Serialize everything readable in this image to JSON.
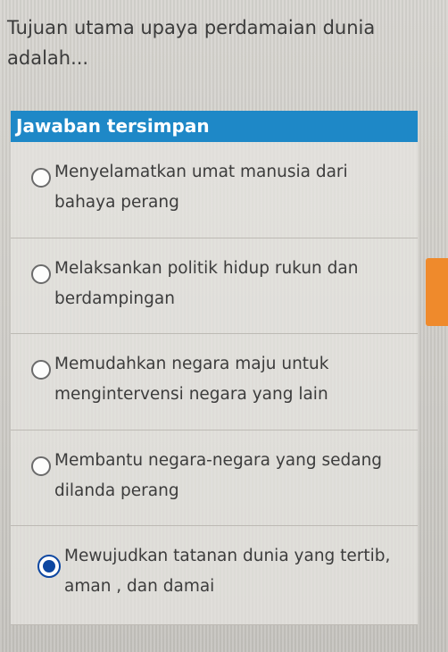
{
  "question": {
    "text": "Tujuan utama upaya perdamaian dunia adalah..."
  },
  "answer_panel": {
    "header": "Jawaban tersimpan",
    "header_color": "#1e88c7",
    "options": [
      {
        "label": "Menyelamatkan umat manusia dari bahaya perang",
        "selected": false
      },
      {
        "label": "Melaksankan politik hidup rukun dan berdampingan",
        "selected": false
      },
      {
        "label": "Memudahkan negara maju untuk mengintervensi negara yang lain",
        "selected": false
      },
      {
        "label": "Membantu negara-negara yang sedang dilanda perang",
        "selected": false
      },
      {
        "label": "Mewujudkan tatanan dunia yang tertib, aman , dan damai",
        "selected": true
      }
    ]
  },
  "side_tab": {
    "color": "#ef8a2c"
  }
}
